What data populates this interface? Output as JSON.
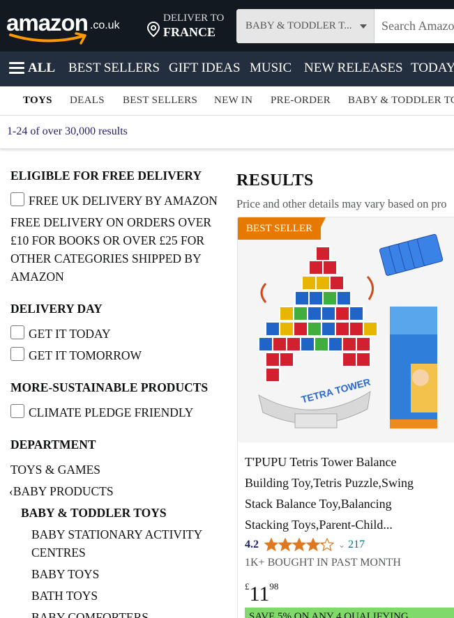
{
  "header": {
    "logo_text": "amazon",
    "logo_tld": ".co.uk",
    "deliver_line1": "DELIVER TO",
    "deliver_line2": "FRANCE",
    "search_category": "BABY & TODDLER T...",
    "search_placeholder": "Search Amazo"
  },
  "nav": {
    "all": "ALL",
    "items": [
      "BEST SELLERS",
      "GIFT IDEAS",
      "MUSIC",
      "NEW RELEASES",
      "TODAY'S"
    ]
  },
  "subnav": {
    "items": [
      "TOYS",
      "DEALS",
      "BEST SELLERS",
      "NEW IN",
      "PRE-ORDER",
      "BABY & TODDLER TO"
    ]
  },
  "results_count": "1-24 of over 30,000 results",
  "sidebar": {
    "free_delivery_heading": "ELIGIBLE FOR FREE DELIVERY",
    "free_uk_delivery": "FREE UK DELIVERY BY AMAZON",
    "free_delivery_note_lines": [
      "FREE DELIVERY ON ORDERS OVER",
      "£10 FOR BOOKS OR OVER £25 FOR",
      "OTHER CATEGORIES SHIPPED BY",
      "AMAZON"
    ],
    "delivery_day_heading": "DELIVERY DAY",
    "get_it_today": "GET IT TODAY",
    "get_it_tomorrow": "GET IT TOMORROW",
    "sustainable_heading": "MORE-SUSTAINABLE PRODUCTS",
    "climate_pledge": "CLIMATE PLEDGE FRIENDLY",
    "department_heading": "DEPARTMENT",
    "toys_games": "TOYS & GAMES",
    "baby_products": "BABY PRODUCTS",
    "baby_toddler_toys": "BABY & TODDLER TOYS",
    "subcats": [
      "BABY STATIONARY ACTIVITY",
      "CENTRES",
      "BABY TOYS",
      "BATH TOYS",
      "BABY COMFORTERS"
    ]
  },
  "results": {
    "title": "RESULTS",
    "subtitle": "Price and other details may vary based on pro"
  },
  "product": {
    "badge": "BEST SELLER",
    "title_lines": [
      "T'PUPU Tetris Tower Balance",
      "Building Toy,Tetris Puzzle,Swing",
      "Stack Balance Toy,Balancing",
      "Stacking Toys,Parent-Child..."
    ],
    "rating": "4.2",
    "rating_value": 4.2,
    "rating_count": "217",
    "bought": "1K+ BOUGHT IN PAST MONTH",
    "price_symbol": "£",
    "price_whole": "11",
    "price_fraction": "98",
    "promo": "SAVE 5% ON ANY 4 QUALIFYING"
  },
  "colors": {
    "header_bg": "#131921",
    "nav_bg": "#232f3e",
    "badge": "#e67a00",
    "star": "#de7921",
    "link": "#007185",
    "promo": "#7fda69"
  }
}
